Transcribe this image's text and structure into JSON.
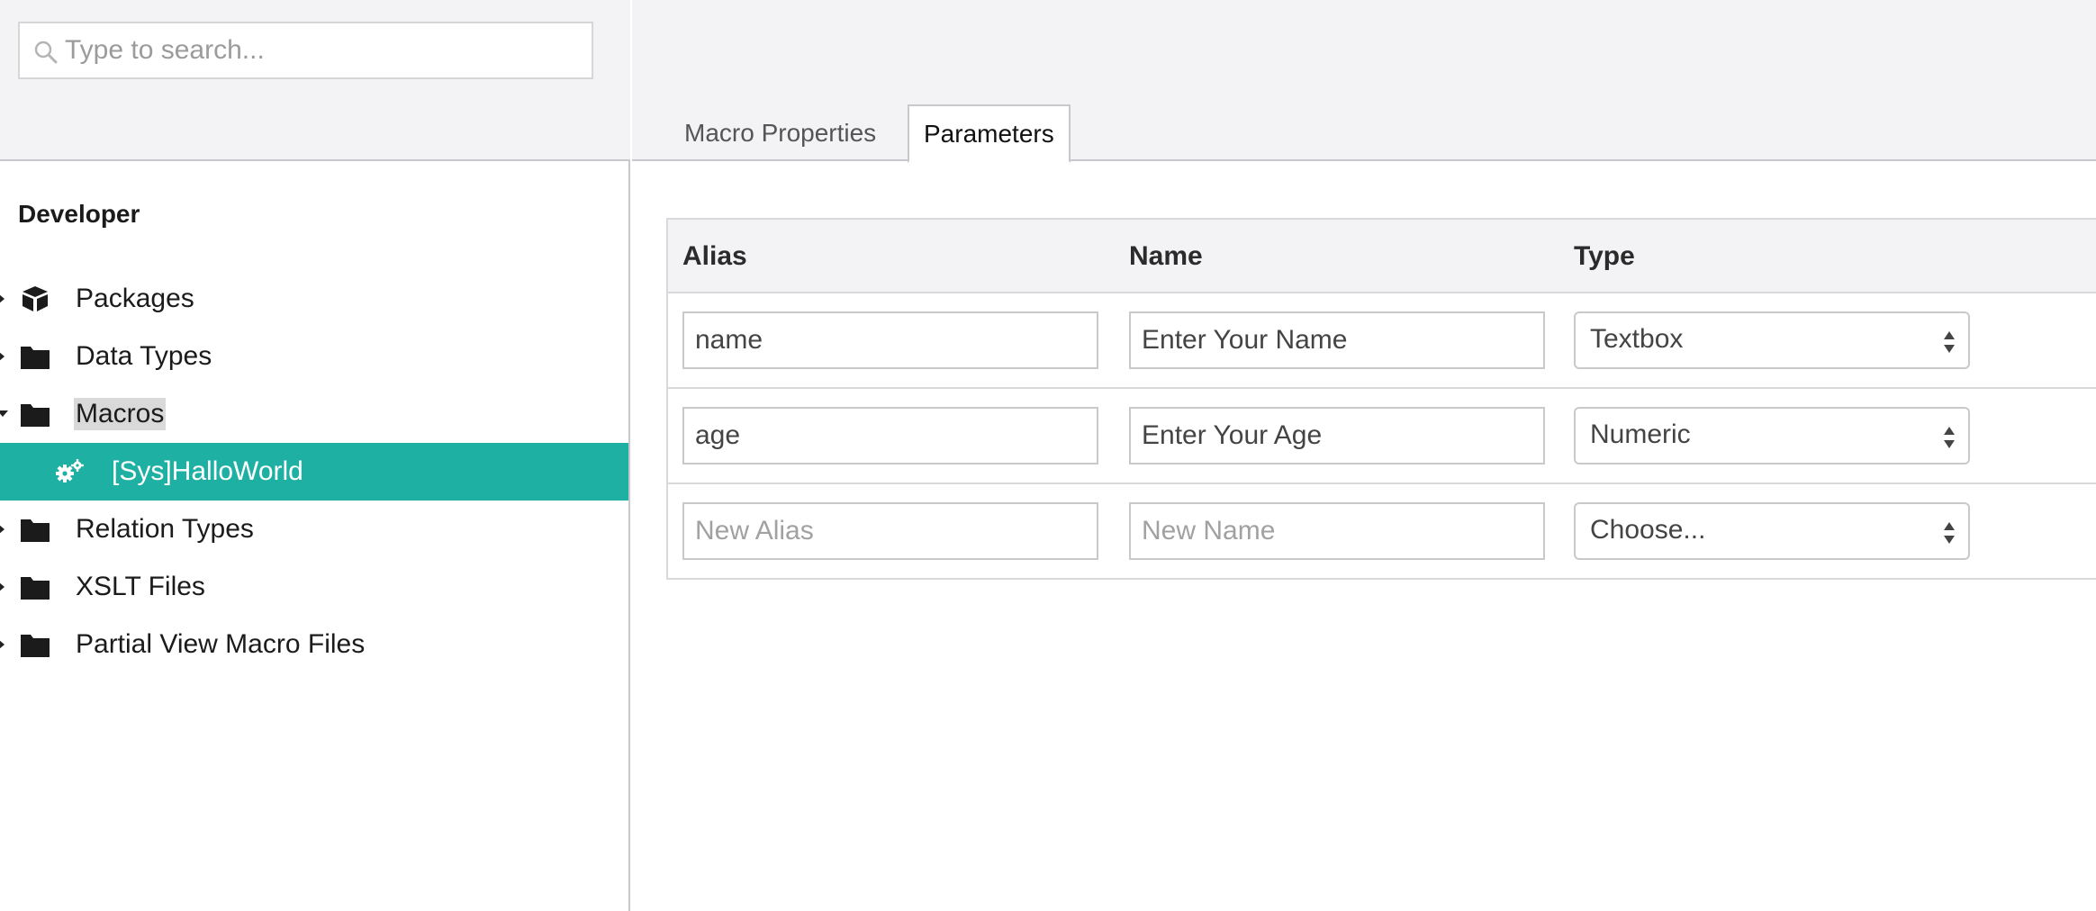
{
  "search": {
    "placeholder": "Type to search..."
  },
  "sidebar": {
    "section_title": "Developer",
    "items": [
      {
        "label": "Packages",
        "icon": "package-icon"
      },
      {
        "label": "Data Types",
        "icon": "folder-icon"
      },
      {
        "label": "Macros",
        "icon": "folder-icon",
        "expanded": true
      },
      {
        "label": "[Sys]HalloWorld",
        "icon": "gears-icon",
        "selected": true
      },
      {
        "label": "Relation Types",
        "icon": "folder-icon"
      },
      {
        "label": "XSLT Files",
        "icon": "folder-icon"
      },
      {
        "label": "Partial View Macro Files",
        "icon": "folder-icon"
      }
    ],
    "selected_color": "#1eb0a3"
  },
  "tabs": [
    {
      "label": "Macro Properties",
      "active": false
    },
    {
      "label": "Parameters",
      "active": true
    }
  ],
  "parameters": {
    "columns": [
      "Alias",
      "Name",
      "Type"
    ],
    "rows": [
      {
        "alias": "name",
        "name": "Enter Your Name",
        "type": "Textbox"
      },
      {
        "alias": "age",
        "name": "Enter Your Age",
        "type": "Numeric"
      }
    ],
    "new_row": {
      "alias_placeholder": "New Alias",
      "name_placeholder": "New Name",
      "type": "Choose..."
    }
  }
}
